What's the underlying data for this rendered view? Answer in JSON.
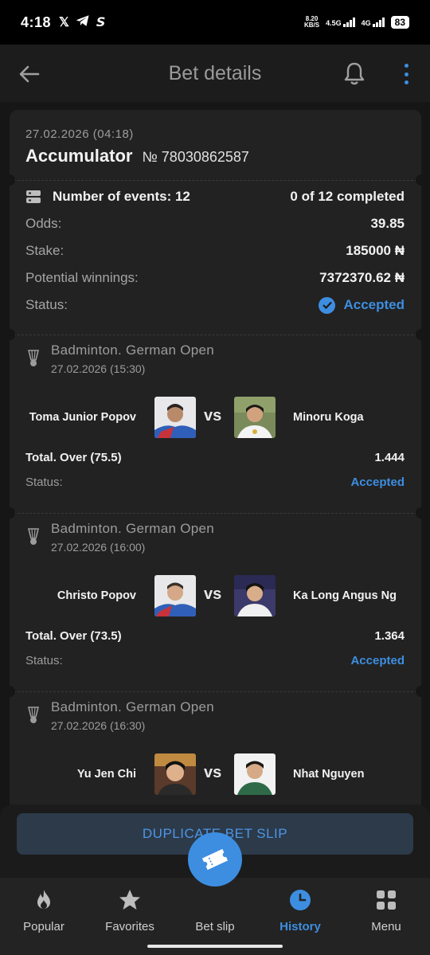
{
  "status_bar": {
    "time": "4:18",
    "speed_top": "8.20",
    "speed_bottom": "KB/S",
    "net1": "4.5G",
    "net2": "4G",
    "battery": "83"
  },
  "app_bar": {
    "title": "Bet details"
  },
  "bet": {
    "date": "27.02.2026",
    "time": "(04:18)",
    "type": "Accumulator",
    "number": "№ 78030862587",
    "events_label": "Number of events: 12",
    "completed": "0 of 12 completed",
    "odds_label": "Odds:",
    "odds": "39.85",
    "stake_label": "Stake:",
    "stake": "185000 ₦",
    "winnings_label": "Potential winnings:",
    "winnings": "7372370.62 ₦",
    "status_label": "Status:",
    "status": "Accepted"
  },
  "events": [
    {
      "league": "Badminton. German Open",
      "datetime": "27.02.2026 (15:30)",
      "player1": "Toma Junior Popov",
      "player2": "Minoru Koga",
      "vs": "vs",
      "market": "Total. Over (75.5)",
      "odds": "1.444",
      "status_label": "Status:",
      "status": "Accepted"
    },
    {
      "league": "Badminton. German Open",
      "datetime": "27.02.2026 (16:00)",
      "player1": "Christo Popov",
      "player2": "Ka Long Angus Ng",
      "vs": "vs",
      "market": "Total. Over (73.5)",
      "odds": "1.364",
      "status_label": "Status:",
      "status": "Accepted"
    },
    {
      "league": "Badminton. German Open",
      "datetime": "27.02.2026 (16:30)",
      "player1": "Yu Jen Chi",
      "player2": "Nhat Nguyen",
      "vs": "vs"
    }
  ],
  "duplicate_button": "DUPLICATE BET SLIP",
  "nav": {
    "popular": "Popular",
    "favorites": "Favorites",
    "betslip": "Bet slip",
    "history": "History",
    "menu": "Menu"
  },
  "colors": {
    "accent": "#3d8ee0",
    "card": "#222222",
    "background": "#161616"
  }
}
